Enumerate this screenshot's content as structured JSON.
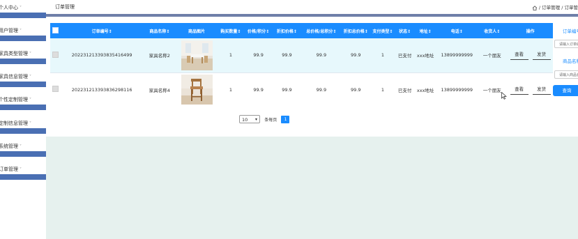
{
  "sidebar": {
    "items": [
      {
        "label": "个人中心"
      },
      {
        "label": "用户管理"
      },
      {
        "label": "家具类型管理"
      },
      {
        "label": "家具信息管理"
      },
      {
        "label": "个性定制管理"
      },
      {
        "label": "定制信息管理"
      },
      {
        "label": "系统管理"
      },
      {
        "label": "订单管理"
      }
    ],
    "caret": "˅"
  },
  "header": {
    "title": "订单管理",
    "breadcrumb": "/ 订单管理 / 订单管"
  },
  "table": {
    "columns": [
      "订单编号↕",
      "商品名称↕",
      "商品图片",
      "购买数量↕",
      "价格/积分↕",
      "折扣价格↕",
      "总价格/总积分↕",
      "折扣总价格↕",
      "支付类型↕",
      "状态↕",
      "地址↕",
      "电话↕",
      "收货人↕",
      "操作"
    ],
    "rows": [
      {
        "order_no": "2022312133938354164​99",
        "name": "家具名称2",
        "qty": "1",
        "price": "99.9",
        "discount": "99.9",
        "total": "99.9",
        "discount_total": "99.9",
        "pay_type": "1",
        "status": "已支付",
        "address": "xxx地址",
        "phone": "13899999999",
        "receiver": "一个朋友",
        "view_label": "查看",
        "ship_label": "发货"
      },
      {
        "order_no": "20223121339383629811​6",
        "name": "家具名称4",
        "qty": "1",
        "price": "99.9",
        "discount": "99.9",
        "total": "99.9",
        "discount_total": "99.9",
        "pay_type": "1",
        "status": "已支付",
        "address": "xxx地址",
        "phone": "13899999999",
        "receiver": "一个朋友",
        "view_label": "查看",
        "ship_label": "发货"
      }
    ]
  },
  "pagination": {
    "page_size": "10",
    "per_page_label": "条每页",
    "current_page": "1"
  },
  "search_panel": {
    "order_label": "订单编号",
    "order_placeholder": "请输入订单编号",
    "name_label": "商品名称",
    "name_placeholder": "请输入商品名称",
    "search_label": "查询"
  },
  "colors": {
    "accent": "#1a8cff",
    "sidebar_bar": "#4a6fb3",
    "footer": "#e6f1ee"
  }
}
